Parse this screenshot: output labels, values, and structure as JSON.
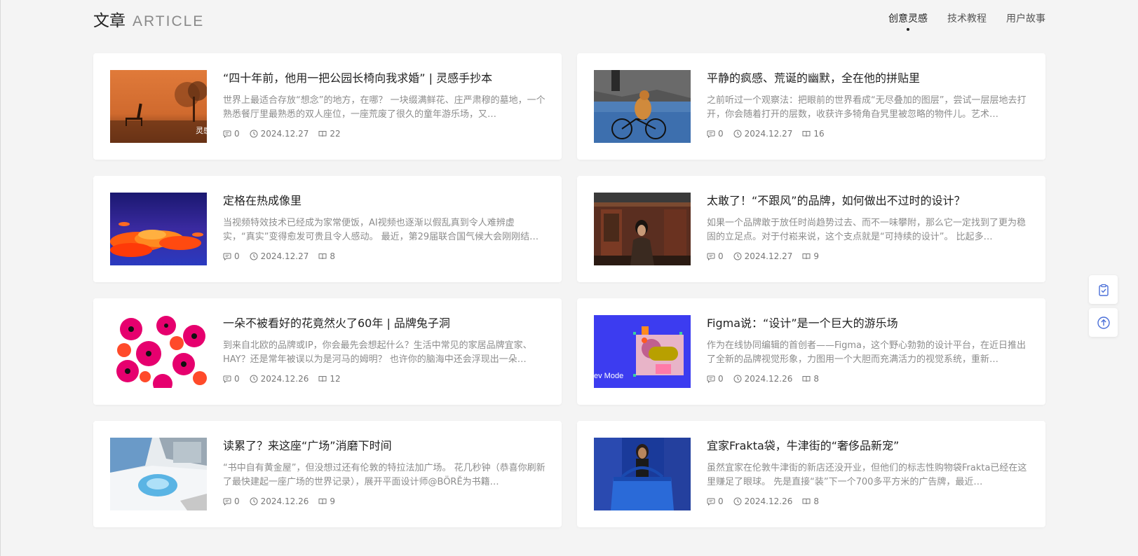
{
  "header": {
    "title_zh": "文章",
    "title_en": "ARTICLE",
    "tabs": [
      {
        "label": "创意灵感",
        "active": true
      },
      {
        "label": "技术教程",
        "active": false
      },
      {
        "label": "用户故事",
        "active": false
      }
    ]
  },
  "articles": [
    {
      "title": "“四十年前，他用一把公园长椅向我求婚” | 灵感手抄本",
      "desc": "世界上最适合存放“想念”的地方，在哪？ 一块缀满鲜花、庄严肃穆的墓地，一个熟悉餐厅里最熟悉的双人座位，一座荒废了很久的童年游乐场，又…",
      "comments": "0",
      "date": "2024.12.27",
      "views": "22",
      "thumb": "bench",
      "thumb_text": "灵感"
    },
    {
      "title": "平静的疯感、荒诞的幽默，全在他的拼贴里",
      "desc": "之前听过一个观察法：把眼前的世界看成“无尽叠加的图层”，尝试一层层地去打开，你会随着打开的层数，收获许多犄角旮旯里被忽略的物件儿。艺术…",
      "comments": "0",
      "date": "2024.12.27",
      "views": "16",
      "thumb": "bicycle-dog"
    },
    {
      "title": "定格在热成像里",
      "desc": "当视频特效技术已经成为家常便饭，AI视频也逐渐以假乱真到令人难辨虚实，“真实”变得愈发可贵且令人感动。 最近，第29届联合国气候大会刚刚结…",
      "comments": "0",
      "date": "2024.12.27",
      "views": "8",
      "thumb": "thermal-clouds"
    },
    {
      "title": "太敢了！“不跟风”的品牌，如何做出不过时的设计？",
      "desc": "如果一个品牌敢于放任时尚趋势过去、而不一味攀附，那么它一定找到了更为稳固的立足点。对于付崧来说，这个支点就是“可持续的设计”。 比起多…",
      "comments": "0",
      "date": "2024.12.27",
      "views": "9",
      "thumb": "woman-temple"
    },
    {
      "title": "一朵不被看好的花竟然火了60年 | 品牌兔子洞",
      "desc": "到来自北欧的品牌或IP，你会最先会想起什么？生活中常见的家居品牌宜家、HAY？还是常年被误以为是河马的姆明？ 也许你的脑海中还会浮现出一朵…",
      "comments": "0",
      "date": "2024.12.26",
      "views": "12",
      "thumb": "poppy-pattern"
    },
    {
      "title": "Figma说：“设计”是一个巨大的游乐场",
      "desc": "作为在线协同编辑的首创者——Figma，这个野心勃勃的设计平台，在近日推出了全新的品牌视觉形象，力图用一个大胆而充满活力的视觉系统，重新…",
      "comments": "0",
      "date": "2024.12.26",
      "views": "8",
      "thumb": "figma",
      "thumb_text": "ev Mode"
    },
    {
      "title": "读累了？来这座“广场”消磨下时间",
      "desc": "“书中自有黄金屋”，但没想过还有伦敦的特拉法加广场。 花几秒钟（恭喜你刷新了最快建起一座广场的世界记录），展开平面设计师@BÖRĚ为书籍…",
      "comments": "0",
      "date": "2024.12.26",
      "views": "9",
      "thumb": "popup-book"
    },
    {
      "title": "宜家Frakta袋，牛津街的“奢侈品新宠”",
      "desc": "虽然宜家在伦敦牛津街的新店还没开业，但他们的标志性购物袋Frakta已经在这里赚足了眼球。 先是直接“装”下一个700多平方米的广告牌，最近…",
      "comments": "0",
      "date": "2024.12.26",
      "views": "8",
      "thumb": "ikea-bag"
    }
  ],
  "float_buttons": [
    {
      "icon": "clipboard-check-icon"
    },
    {
      "icon": "arrow-up-circle-icon"
    }
  ],
  "colors": {
    "background": "#f4f4f4",
    "card": "#ffffff",
    "title": "#222222",
    "desc": "#8c8c8c",
    "accent_blue": "#4a6fd8"
  }
}
